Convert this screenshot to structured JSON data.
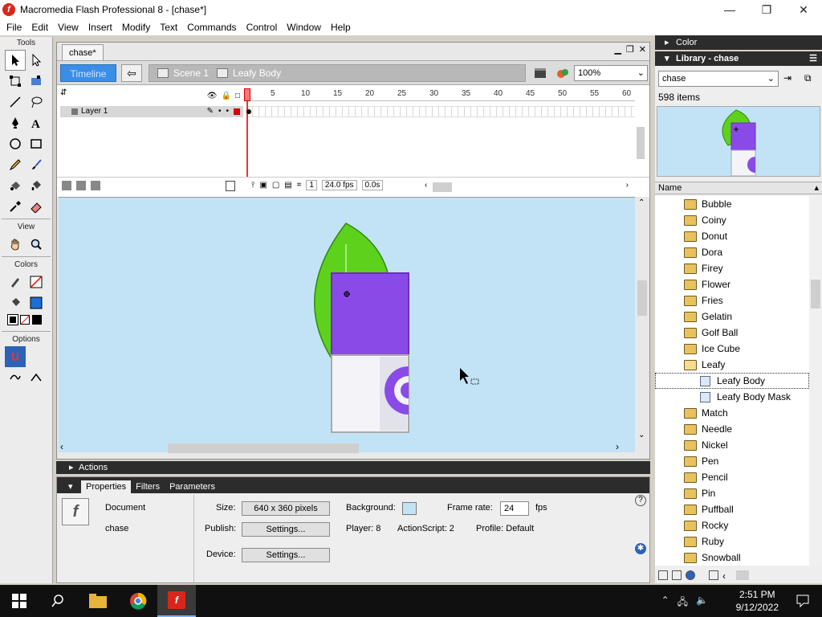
{
  "window": {
    "title": "Macromedia Flash Professional 8 - [chase*]",
    "app_icon": "f",
    "minimize": "—",
    "maximize": "❐",
    "close": "✕"
  },
  "menu": [
    "File",
    "Edit",
    "View",
    "Insert",
    "Modify",
    "Text",
    "Commands",
    "Control",
    "Window",
    "Help"
  ],
  "tools": {
    "header": "Tools",
    "view_header": "View",
    "colors_header": "Colors",
    "options_header": "Options"
  },
  "document": {
    "tab": "chase*",
    "timeline_button": "Timeline",
    "breadcrumb": [
      "Scene 1",
      "Leafy Body"
    ],
    "zoom": "100%"
  },
  "timeline": {
    "layer_name": "Layer 1",
    "ruler_numbers": [
      "5",
      "10",
      "15",
      "20",
      "25",
      "30",
      "35",
      "40",
      "45",
      "50",
      "55",
      "60"
    ],
    "current_frame": "1",
    "fps": "24.0 fps",
    "elapsed": "0.0s"
  },
  "panels": {
    "actions": "Actions",
    "tabs": [
      "Properties",
      "Filters",
      "Parameters"
    ],
    "document_label": "Document",
    "document_name": "chase",
    "size_label": "Size:",
    "size_value": "640 x 360 pixels",
    "background_label": "Background:",
    "frame_rate_label": "Frame rate:",
    "frame_rate_value": "24",
    "fps_unit": "fps",
    "publish_label": "Publish:",
    "settings_button": "Settings...",
    "player_label": "Player: 8",
    "actionscript_label": "ActionScript:  2",
    "profile_label": "Profile:  Default",
    "device_label": "Device:",
    "device_settings": "Settings..."
  },
  "right": {
    "color_panel": "Color",
    "library_panel": "Library - chase",
    "library_select": "chase",
    "item_count": "598 items",
    "name_header": "Name",
    "items": [
      {
        "name": "Bubble",
        "type": "folder"
      },
      {
        "name": "Coiny",
        "type": "folder"
      },
      {
        "name": "Donut",
        "type": "folder"
      },
      {
        "name": "Dora",
        "type": "folder"
      },
      {
        "name": "Firey",
        "type": "folder"
      },
      {
        "name": "Flower",
        "type": "folder"
      },
      {
        "name": "Fries",
        "type": "folder"
      },
      {
        "name": "Gelatin",
        "type": "folder"
      },
      {
        "name": "Golf Ball",
        "type": "folder"
      },
      {
        "name": "Ice Cube",
        "type": "folder"
      },
      {
        "name": "Leafy",
        "type": "folder-open"
      },
      {
        "name": "Leafy Body",
        "type": "symbol",
        "selected": true
      },
      {
        "name": "Leafy Body Mask",
        "type": "symbol"
      },
      {
        "name": "Match",
        "type": "folder"
      },
      {
        "name": "Needle",
        "type": "folder"
      },
      {
        "name": "Nickel",
        "type": "folder"
      },
      {
        "name": "Pen",
        "type": "folder"
      },
      {
        "name": "Pencil",
        "type": "folder"
      },
      {
        "name": "Pin",
        "type": "folder"
      },
      {
        "name": "Puffball",
        "type": "folder"
      },
      {
        "name": "Rocky",
        "type": "folder"
      },
      {
        "name": "Ruby",
        "type": "folder"
      },
      {
        "name": "Snowball",
        "type": "folder"
      }
    ]
  },
  "taskbar": {
    "time": "2:51 PM",
    "date": "9/12/2022"
  },
  "colors": {
    "stage_bg": "#c2e3f5",
    "leaf_green": "#5ed11c",
    "body_purple": "#8a4ae8",
    "timeline_blue": "#3b8ee6"
  }
}
